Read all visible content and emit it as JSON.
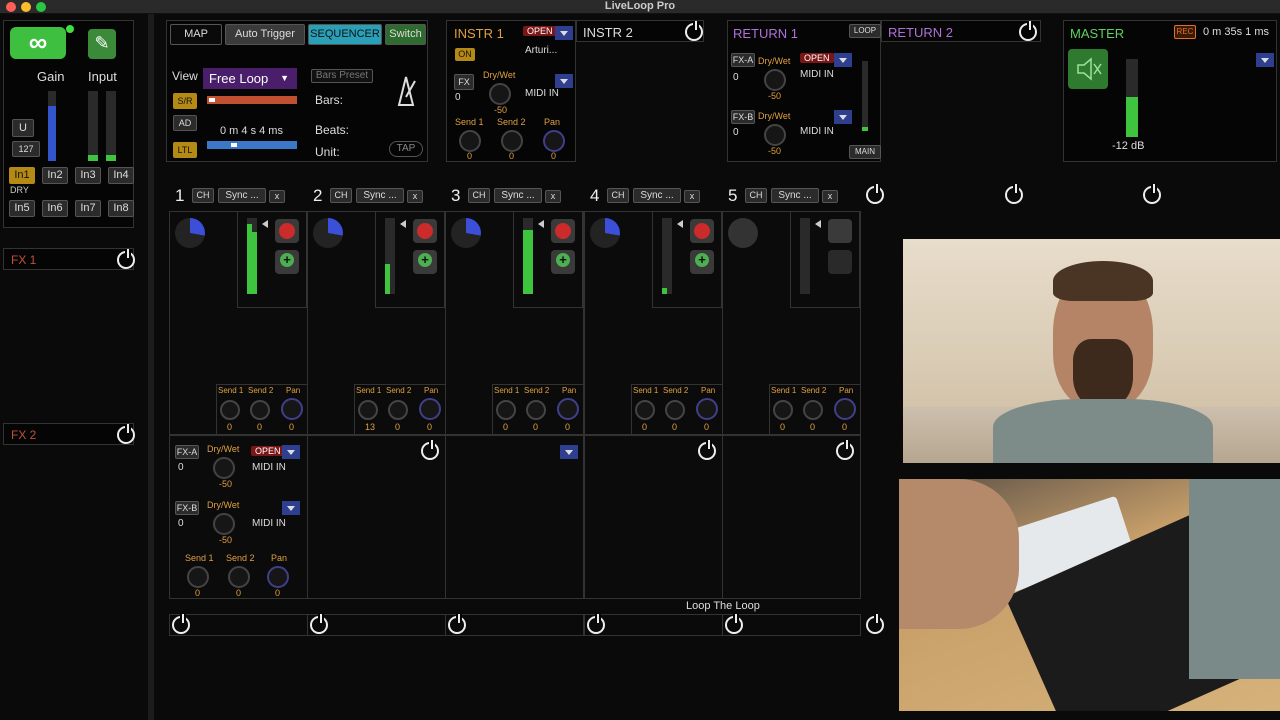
{
  "app": {
    "title": "LiveLoop Pro"
  },
  "left": {
    "gain": "Gain",
    "input": "Input",
    "u": "U",
    "vel": "127",
    "dry": "DRY",
    "inputs": [
      "In1",
      "In2",
      "In3",
      "In4",
      "In5",
      "In6",
      "In7",
      "In8"
    ],
    "fx1": "FX 1",
    "fx2": "FX 2"
  },
  "top": {
    "map": "MAP",
    "auto_trigger": "Auto Trigger",
    "sequencer": "SEQUENCER",
    "switch": "Switch",
    "view": "View",
    "sr": "S/R",
    "ad": "AD",
    "ltl": "LTL",
    "free_loop": "Free Loop",
    "bars_preset": "Bars Preset",
    "bars": "Bars:",
    "beats": "Beats:",
    "unit": "Unit:",
    "time": "0 m  4  s 4 ms",
    "tap": "TAP"
  },
  "instr1": {
    "title": "INSTR 1",
    "open": "OPEN",
    "on": "ON",
    "device": "Arturi...",
    "fx": "FX",
    "fx_val": "0",
    "drywet": "Dry/Wet",
    "dw_val": "-50",
    "midi_in": "MIDI IN",
    "send1": "Send 1",
    "send2": "Send 2",
    "pan": "Pan",
    "v1": "0",
    "v2": "0",
    "v3": "0"
  },
  "instr2": {
    "title": "INSTR 2"
  },
  "return1": {
    "title": "RETURN 1",
    "loop": "LOOP",
    "fxa": "FX-A",
    "fxb": "FX-B",
    "a_val": "0",
    "b_val": "0",
    "drywet": "Dry/Wet",
    "dw_a": "-50",
    "dw_b": "-50",
    "open": "OPEN",
    "midi_in": "MIDI IN",
    "main": "MAIN"
  },
  "return2": {
    "title": "RETURN 2"
  },
  "master": {
    "title": "MASTER",
    "rec": "REC",
    "time": "0  m 35s 1 ms",
    "db": "-12 dB"
  },
  "channels": [
    {
      "num": "1",
      "ch": "CH",
      "sync": "Sync ...",
      "x": "x",
      "s1": "0",
      "s2": "0",
      "pan": "0"
    },
    {
      "num": "2",
      "ch": "CH",
      "sync": "Sync ...",
      "x": "x",
      "s1": "13",
      "s2": "0",
      "pan": "0"
    },
    {
      "num": "3",
      "ch": "CH",
      "sync": "Sync ...",
      "x": "x",
      "s1": "0",
      "s2": "0",
      "pan": "0"
    },
    {
      "num": "4",
      "ch": "CH",
      "sync": "Sync ...",
      "x": "x",
      "s1": "0",
      "s2": "0",
      "pan": "0"
    },
    {
      "num": "5",
      "ch": "CH",
      "sync": "Sync ...",
      "x": "x",
      "s1": "0",
      "s2": "0",
      "pan": "0"
    }
  ],
  "send_labels": {
    "s1": "Send 1",
    "s2": "Send 2",
    "pan": "Pan"
  },
  "fxbox": {
    "fxa": "FX-A",
    "fxb": "FX-B",
    "a": "0",
    "b": "0",
    "drywet": "Dry/Wet",
    "dwa": "-50",
    "dwb": "-50",
    "open": "OPEN",
    "midi_in": "MIDI IN",
    "send1": "Send 1",
    "send2": "Send 2",
    "pan": "Pan",
    "v1": "0",
    "v2": "0",
    "v3": "0"
  },
  "loop_the_loop": "Loop The Loop"
}
